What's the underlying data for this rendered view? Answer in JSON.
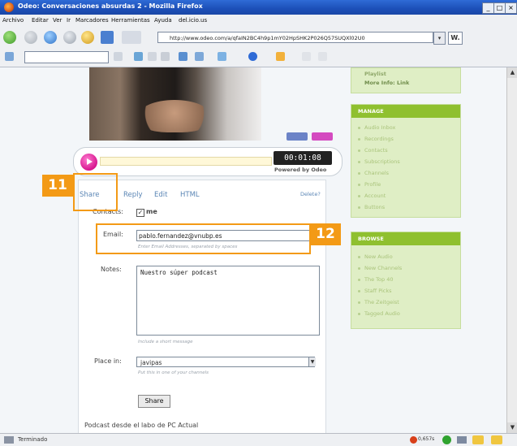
{
  "window": {
    "title": "Odeo: Conversaciones absurdas 2 - Mozilla Firefox",
    "min": "_",
    "max": "□",
    "close": "×"
  },
  "menu": [
    "Archivo",
    "Editar",
    "Ver",
    "Ir",
    "Marcadores",
    "Herramientas",
    "Ayuda",
    "del.icio.us"
  ],
  "address": {
    "url": "http://www.odeo.com/a/qfaIN2BC4h9p1mY02HpSHK2P026Q57SUQXl02U0",
    "go_arrow": "▾",
    "w_label": "W."
  },
  "player": {
    "time": "00:01:08",
    "powered": "Powered by Odeo"
  },
  "tabs": [
    {
      "label": "Share"
    },
    {
      "label": "Reply"
    },
    {
      "label": "Edit"
    },
    {
      "label": "HTML"
    }
  ],
  "delete_label": "Delete?",
  "form": {
    "contacts_label": "Contacts:",
    "contacts_me": "me",
    "checkbox_mark": "✓",
    "email_label": "Email:",
    "email_value": "pablo.fernandez@vnubp.es",
    "email_hint": "Enter Email Addresses, separated by spaces",
    "notes_label": "Notes:",
    "notes_value": "Nuestro súper podcast",
    "notes_hint": "Include a short message",
    "place_label": "Place in:",
    "place_value": "javipas",
    "place_hint": "Put this in one of your channels",
    "share_button": "Share"
  },
  "footer_text": "Podcast desde el labo de PC Actual",
  "callouts": {
    "a": "11",
    "b": "12"
  },
  "sidebar": {
    "top_items": [
      "Playlist",
      "More Info: Link"
    ],
    "manage": {
      "title": "MANAGE",
      "items": [
        "Audio Inbox",
        "Recordings",
        "Contacts",
        "Subscriptions",
        "Channels",
        "Profile",
        "Account",
        "Buttons"
      ]
    },
    "browse": {
      "title": "BROWSE",
      "items": [
        "New Audio",
        "New Channels",
        "The Top 40",
        "Staff Picks",
        "The Zeitgeist",
        "Tagged Audio"
      ]
    }
  },
  "status": {
    "text": "Terminado",
    "speed": "0,657s"
  },
  "colors": {
    "accent": "#f39a16",
    "sidebar_green": "#8fc02f",
    "play_pink": "#d7178f",
    "link_blue": "#5b86b5"
  }
}
